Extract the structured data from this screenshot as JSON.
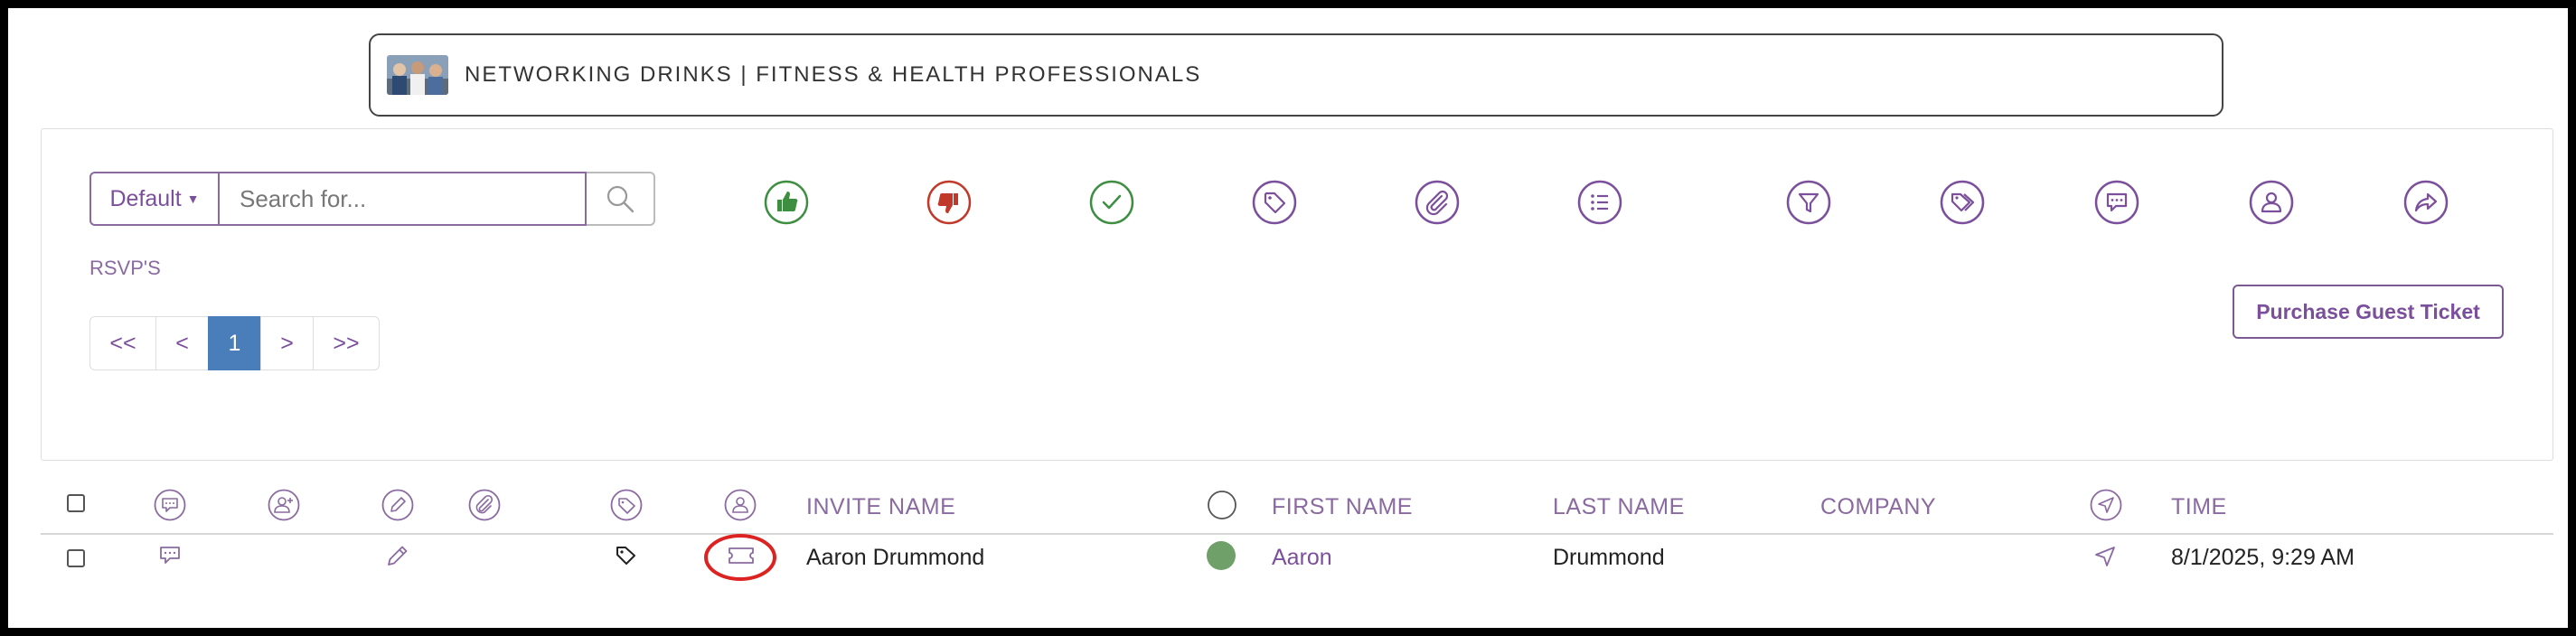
{
  "event": {
    "title": "NETWORKING DRINKS | FITNESS & HEALTH PROFESSIONALS",
    "thumbnail_icon": "event-photo"
  },
  "toolbar": {
    "default_label": "Default",
    "search_placeholder": "Search for...",
    "search_value": "",
    "action_icons": [
      {
        "name": "thumbs-up-icon",
        "color": "#3e8e41"
      },
      {
        "name": "thumbs-down-icon",
        "color": "#c0392b"
      },
      {
        "name": "check-icon",
        "color": "#3e8e41"
      },
      {
        "name": "tag-icon",
        "color": "#7b4f9c"
      },
      {
        "name": "paperclip-icon",
        "color": "#7b4f9c"
      },
      {
        "name": "list-icon",
        "color": "#7b4f9c"
      },
      {
        "name": "filter-icon",
        "color": "#7b4f9c"
      },
      {
        "name": "tags-icon",
        "color": "#7b4f9c"
      },
      {
        "name": "comment-icon",
        "color": "#7b4f9c"
      },
      {
        "name": "user-icon",
        "color": "#7b4f9c"
      },
      {
        "name": "share-icon",
        "color": "#7b4f9c"
      }
    ]
  },
  "rsvp_label": "RSVP'S",
  "pagination": {
    "first": "<<",
    "prev": "<",
    "current": "1",
    "next": ">",
    "last": ">>"
  },
  "purchase_button": "Purchase Guest Ticket",
  "table": {
    "header_icons": [
      "checkbox",
      "comment-icon",
      "add-user-icon",
      "edit-icon",
      "paperclip-icon",
      "tag-icon",
      "user-icon",
      "status-icon",
      "send-icon"
    ],
    "columns": {
      "invite_name": "INVITE NAME",
      "first_name": "FIRST NAME",
      "last_name": "LAST NAME",
      "company": "COMPANY",
      "time": "TIME"
    },
    "rows": [
      {
        "invite_name": "Aaron Drummond",
        "first_name": "Aaron",
        "last_name": "Drummond",
        "company": "",
        "time": "8/1/2025, 9:29 AM",
        "status_color": "#6fa06a",
        "icons": [
          "comment-icon",
          "edit-icon",
          "tag-icon",
          "ticket-icon",
          "send-icon"
        ]
      }
    ]
  },
  "colors": {
    "accent": "#7b4f9c",
    "pagination_active": "#4a7ebb",
    "highlight": "#dd2222"
  }
}
